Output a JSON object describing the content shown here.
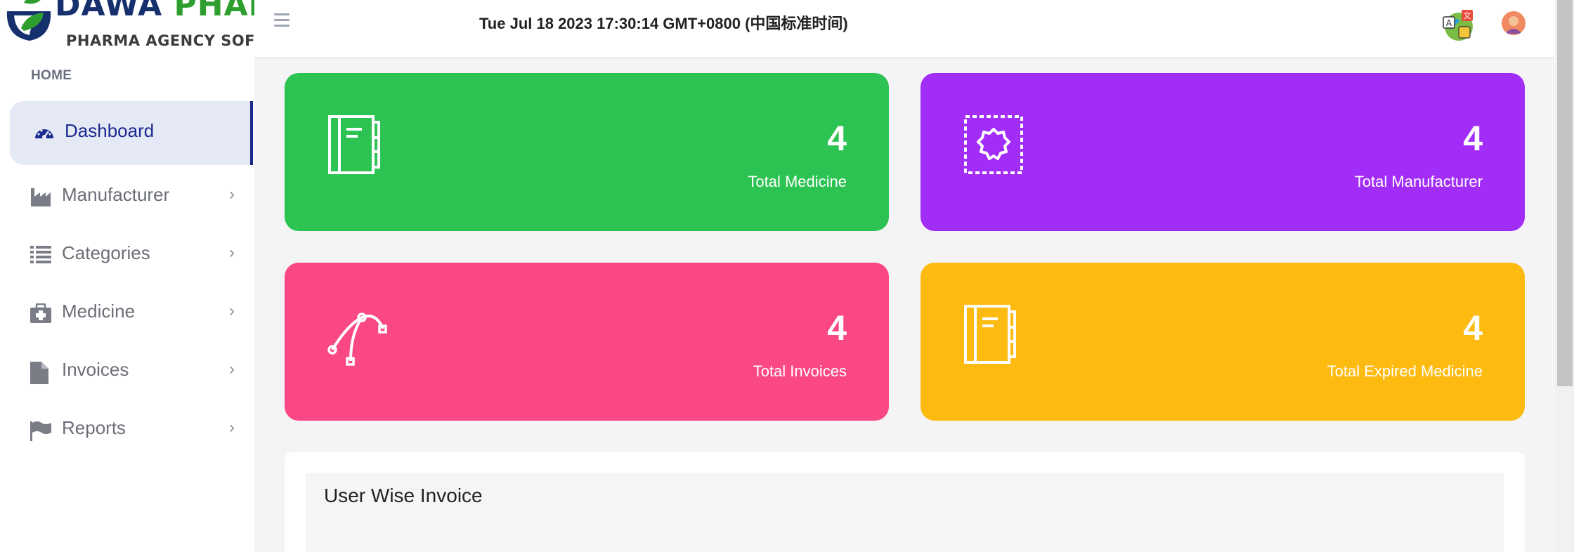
{
  "app": {
    "brand_part1": "DAWA",
    "brand_part2": "PHARMA",
    "tagline": "PHARMA AGENCY SOFTWARE"
  },
  "header": {
    "datetime": "Tue Jul 18 2023 17:30:14 GMT+0800 (中国标准时间)",
    "menu_icon": "hamburger-icon",
    "translate_icon": "translate-icon",
    "avatar_icon": "user-avatar"
  },
  "sidebar": {
    "heading": "HOME",
    "items": [
      {
        "label": "Dashboard",
        "icon": "gauge-icon",
        "active": true
      },
      {
        "label": "Manufacturer",
        "icon": "factory-icon",
        "chevron": "›"
      },
      {
        "label": "Categories",
        "icon": "list-icon",
        "chevron": "›"
      },
      {
        "label": "Medicine",
        "icon": "medkit-icon",
        "chevron": "›"
      },
      {
        "label": "Invoices",
        "icon": "file-icon",
        "chevron": "›"
      },
      {
        "label": "Reports",
        "icon": "flag-icon",
        "chevron": "›"
      }
    ]
  },
  "cards": [
    {
      "value": "4",
      "label": "Total Medicine",
      "color": "#2dc353",
      "icon": "notebook-icon"
    },
    {
      "value": "4",
      "label": "Total Manufacturer",
      "color": "#a22df7",
      "icon": "gear-icon"
    },
    {
      "value": "4",
      "label": "Total Invoices",
      "color": "#fa4786",
      "icon": "bezier-curve-icon"
    },
    {
      "value": "4",
      "label": "Total Expired Medicine",
      "color": "#fdbb11",
      "icon": "notebook-icon"
    }
  ],
  "panel": {
    "title": "User Wise Invoice"
  },
  "colors": {
    "accent": "#1b2a8f",
    "brand_green": "#2e9f2e",
    "brand_navy": "#16306e"
  }
}
